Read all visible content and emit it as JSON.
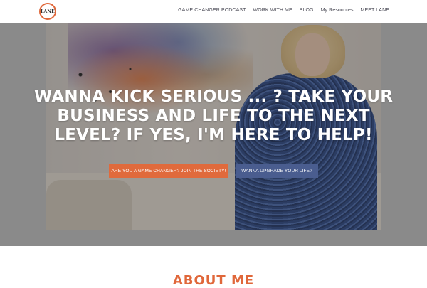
{
  "logo": {
    "text": "LANE"
  },
  "nav": {
    "items": [
      {
        "label": "GAME CHANGER PODCAST"
      },
      {
        "label": "WORK WITH ME"
      },
      {
        "label": "BLOG"
      },
      {
        "label": "My Resources"
      },
      {
        "label": "MEET LANE"
      }
    ]
  },
  "hero": {
    "headline": "WANNA KICK SERIOUS ... ? TAKE YOUR BUSINESS AND LIFE TO THE NEXT LEVEL? IF YES, I'M HERE TO HELP!",
    "primary_button": "ARE YOU A GAME CHANGER? JOIN THE SOCIETY!",
    "secondary_button": "WANNA UPGRADE YOUR LIFE?"
  },
  "about": {
    "heading": "ABOUT ME"
  },
  "colors": {
    "accent": "#e06a3c",
    "secondary_button": "#4a5d8f",
    "nav_text": "#4a4a55",
    "hero_band": "#8a8a8a"
  }
}
